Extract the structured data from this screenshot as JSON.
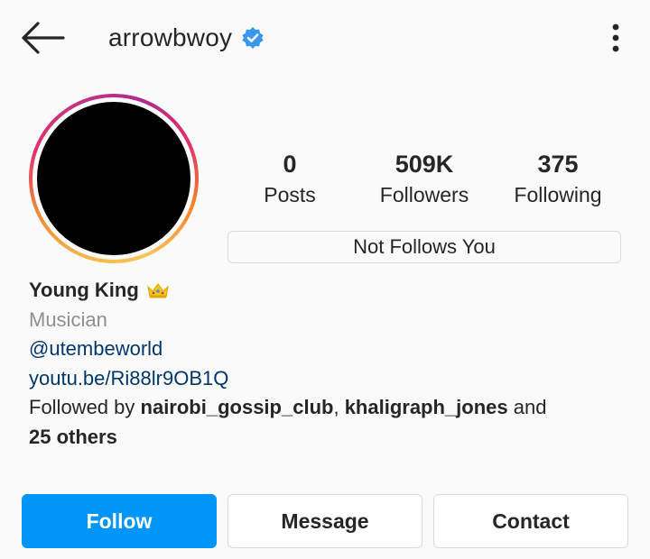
{
  "header": {
    "username": "arrowbwoy",
    "verified": true,
    "icons": {
      "back": "arrow-left-icon",
      "verified": "verified-badge-icon",
      "menu": "more-vertical-icon"
    }
  },
  "stats": {
    "posts": {
      "value": "0",
      "label": "Posts"
    },
    "followers": {
      "value": "509K",
      "label": "Followers"
    },
    "following": {
      "value": "375",
      "label": "Following"
    }
  },
  "follows_you_badge": "Not Follows You",
  "bio": {
    "name": "Young King",
    "name_emoji": "crown-emoji-icon",
    "category": "Musician",
    "mention": "@utembeworld",
    "website": "youtu.be/Ri88lr9OB1Q",
    "followed_by_prefix": "Followed by ",
    "followed_by_user_1": "nairobi_gossip_club",
    "separator": ", ",
    "followed_by_user_2": "khaligraph_jones",
    "followed_by_and": " and",
    "followed_by_others": "25 others"
  },
  "actions": {
    "follow_label": "Follow",
    "message_label": "Message",
    "contact_label": "Contact"
  },
  "colors": {
    "accent_blue": "#0095f6",
    "link_blue": "#00376b",
    "secondary_text": "#8e8e8e",
    "verified_blue": "#3897f0"
  }
}
